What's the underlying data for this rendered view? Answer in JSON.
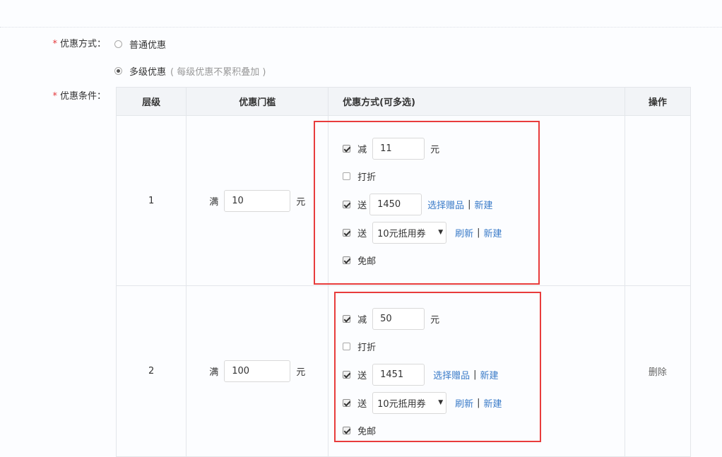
{
  "form": {
    "discount_type_label": "优惠方式：",
    "discount_condition_label": "优惠条件：",
    "required_mark": "*",
    "options": [
      {
        "label": "普通优惠",
        "hint": "",
        "selected": false
      },
      {
        "label": "多级优惠",
        "hint": "( 每级优惠不累积叠加 )",
        "selected": true
      }
    ]
  },
  "table": {
    "headers": {
      "level": "层级",
      "threshold": "优惠门槛",
      "methods": "优惠方式(可多选)",
      "ops": "操作"
    },
    "tiers": [
      {
        "level": "1",
        "threshold_prefix": "满",
        "threshold_value": "10",
        "threshold_unit": "元",
        "reduce": {
          "checked": true,
          "label": "减",
          "value": "11",
          "unit": "元"
        },
        "discount": {
          "checked": false,
          "label": "打折"
        },
        "gift": {
          "checked": true,
          "label": "送",
          "value": "1450",
          "link_select": "选择赠品",
          "separator": "|",
          "link_new": "新建"
        },
        "coupon": {
          "checked": true,
          "label": "送",
          "selected": "10元抵用券",
          "link_refresh": "刷新",
          "separator": "|",
          "link_new": "新建"
        },
        "free_shipping": {
          "checked": true,
          "label": "免邮"
        },
        "action": ""
      },
      {
        "level": "2",
        "threshold_prefix": "满",
        "threshold_value": "100",
        "threshold_unit": "元",
        "reduce": {
          "checked": true,
          "label": "减",
          "value": "50",
          "unit": "元"
        },
        "discount": {
          "checked": false,
          "label": "打折"
        },
        "gift": {
          "checked": true,
          "label": "送",
          "value": "1451",
          "link_select": "选择赠品",
          "separator": "|",
          "link_new": "新建"
        },
        "coupon": {
          "checked": true,
          "label": "送",
          "selected": "10元抵用券",
          "link_refresh": "刷新",
          "separator": "|",
          "link_new": "新建"
        },
        "free_shipping": {
          "checked": true,
          "label": "免邮"
        },
        "action": "删除"
      }
    ]
  },
  "colors": {
    "highlight_border": "#e83c3c",
    "link": "#3a7bc8",
    "required": "#e4393c",
    "header_bg": "#f2f4f7"
  }
}
